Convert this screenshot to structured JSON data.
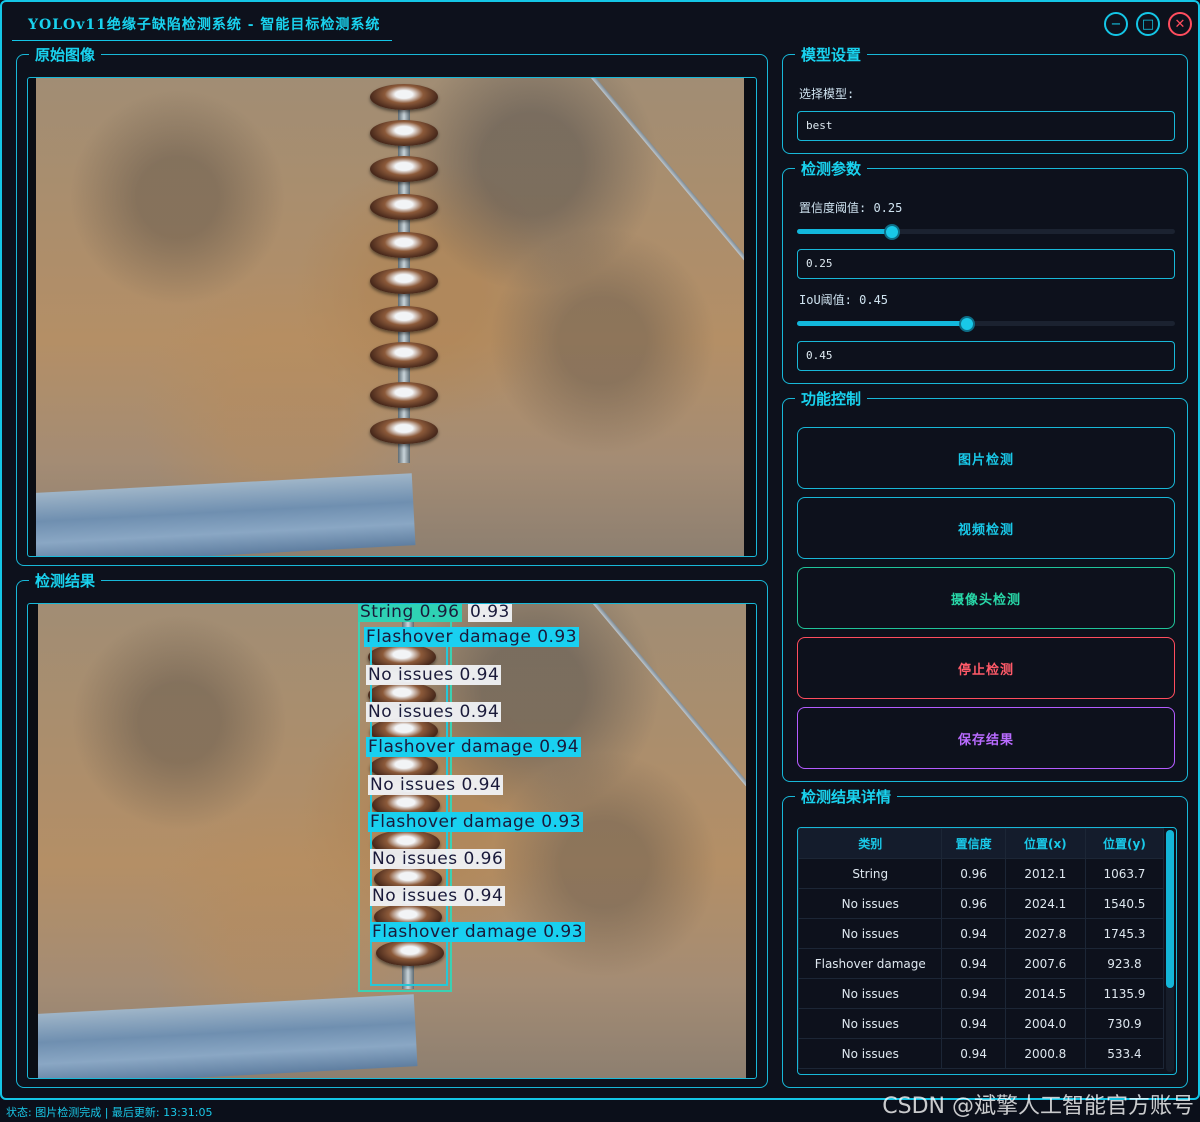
{
  "window": {
    "title": "YOLOv11绝缘子缺陷检测系统 - 智能目标检测系统"
  },
  "original_panel": {
    "title": "原始图像"
  },
  "result_panel": {
    "title": "检测结果",
    "detections": [
      {
        "label": "String 0.96",
        "style": "teal"
      },
      {
        "label": "0.93",
        "style": "white"
      },
      {
        "label": "Flashover damage 0.93",
        "style": "cyan"
      },
      {
        "label": "No issues 0.94",
        "style": "white"
      },
      {
        "label": "No issues 0.94",
        "style": "white"
      },
      {
        "label": "Flashover damage 0.94",
        "style": "cyan"
      },
      {
        "label": "No issues 0.94",
        "style": "white"
      },
      {
        "label": "Flashover damage 0.93",
        "style": "cyan"
      },
      {
        "label": "No issues 0.96",
        "style": "white"
      },
      {
        "label": "No issues 0.94",
        "style": "white"
      },
      {
        "label": "Flashover damage 0.93",
        "style": "cyan"
      }
    ]
  },
  "model_settings": {
    "title": "模型设置",
    "select_label": "选择模型:",
    "model_value": "best"
  },
  "params": {
    "title": "检测参数",
    "conf_label": "置信度阈值: 0.25",
    "conf_value": "0.25",
    "conf_level": 0.25,
    "iou_label": "IoU阈值: 0.45",
    "iou_value": "0.45",
    "iou_level": 0.45
  },
  "controls": {
    "title": "功能控制",
    "image_detect": "图片检测",
    "video_detect": "视频检测",
    "camera_detect": "摄像头检测",
    "stop_detect": "停止检测",
    "save_results": "保存结果"
  },
  "details": {
    "title": "检测结果详情",
    "columns": [
      "类别",
      "置信度",
      "位置(x)",
      "位置(y)"
    ],
    "rows": [
      [
        "String",
        "0.96",
        "2012.1",
        "1063.7"
      ],
      [
        "No issues",
        "0.96",
        "2024.1",
        "1540.5"
      ],
      [
        "No issues",
        "0.94",
        "2027.8",
        "1745.3"
      ],
      [
        "Flashover damage",
        "0.94",
        "2007.6",
        "923.8"
      ],
      [
        "No issues",
        "0.94",
        "2014.5",
        "1135.9"
      ],
      [
        "No issues",
        "0.94",
        "2004.0",
        "730.9"
      ],
      [
        "No issues",
        "0.94",
        "2000.8",
        "533.4"
      ]
    ]
  },
  "status": {
    "text": "状态: 图片检测完成 | 最后更新: 13:31:05"
  },
  "watermark": "CSDN @斌擎人工智能官方账号",
  "colors": {
    "accent": "#14c6e6",
    "stop": "#ff4d5e",
    "camera": "#20c49a",
    "save": "#b45cff"
  }
}
